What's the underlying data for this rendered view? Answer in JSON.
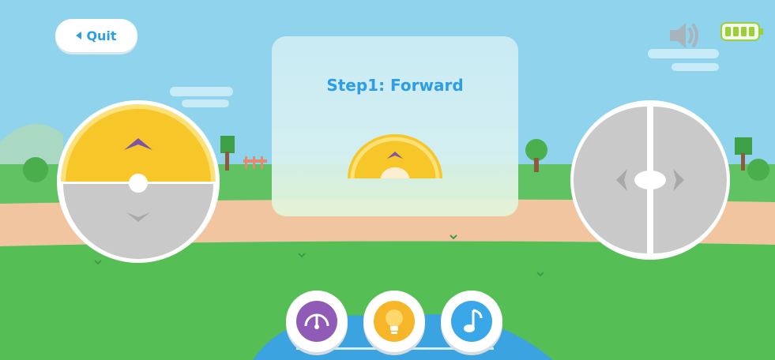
{
  "header": {
    "quit_label": "Quit"
  },
  "instruction": {
    "title": "Step1: Forward"
  },
  "status": {
    "battery_level": 1.0
  },
  "icons": {
    "quit": "back-arrow-icon",
    "sound": "speaker-icon",
    "battery": "battery-icon",
    "speed": "speedometer-icon",
    "light": "light-bulb-icon",
    "music": "music-note-icon"
  },
  "colors": {
    "accent": "#2d9ee3",
    "sky": "#8fd3ec",
    "grass": "#55bf55",
    "path": "#f1c5a0",
    "joystick_active": "#f7c629",
    "joystick_inactive": "#c9c9c9",
    "arrow": "#7b55a8",
    "speed_button": "#8f5bb6",
    "light_button": "#f7b62a",
    "music_button": "#3aa8e8"
  }
}
